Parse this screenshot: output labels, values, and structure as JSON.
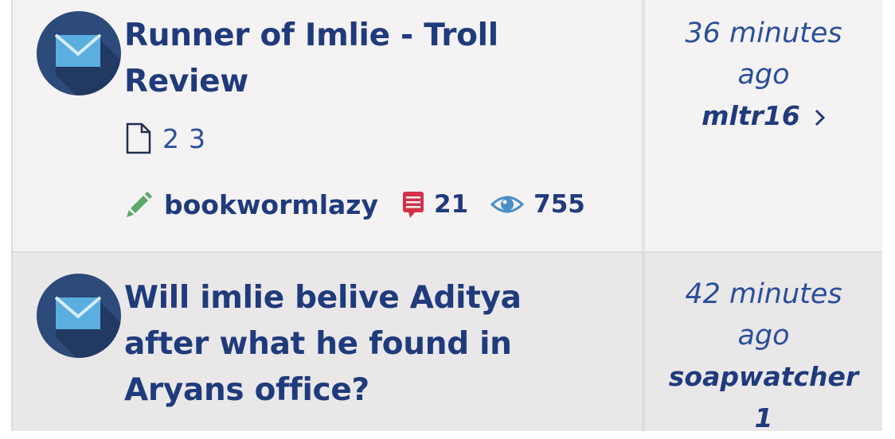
{
  "topics": [
    {
      "title": "Runner of Imlie - Troll Review",
      "title_line1": "Runner of Imlie - Troll",
      "title_line2": "Review",
      "pages": [
        "2",
        "3"
      ],
      "author": "bookwormlazy",
      "replies": "21",
      "views": "755",
      "last_post_time_line1": "36 minutes",
      "last_post_time_line2": "ago",
      "last_post_user": "mltr16"
    },
    {
      "title_line1": "Will imlie belive Aditya",
      "title_line2": "after what he found in",
      "title_line3": "Aryans office?",
      "last_post_time_line1": "42 minutes",
      "last_post_time_line2": "ago",
      "last_post_user_line1": "soapwatcher",
      "last_post_user_line2": "1"
    }
  ],
  "icons": {
    "avatar": "envelope-icon",
    "pages": "document-icon",
    "author": "pencil-icon",
    "replies": "comment-icon",
    "views": "eye-icon",
    "last_post": "chevron-right-icon"
  },
  "colors": {
    "link": "#1f3b7c",
    "row_bg": "#f4f2f3",
    "row_alt_bg": "#e9e7e8",
    "pencil": "#5aa86a",
    "comment": "#d2334a",
    "eye": "#4a90c8",
    "avatar_bg": "#2c4a7a",
    "envelope": "#5aaee0"
  }
}
